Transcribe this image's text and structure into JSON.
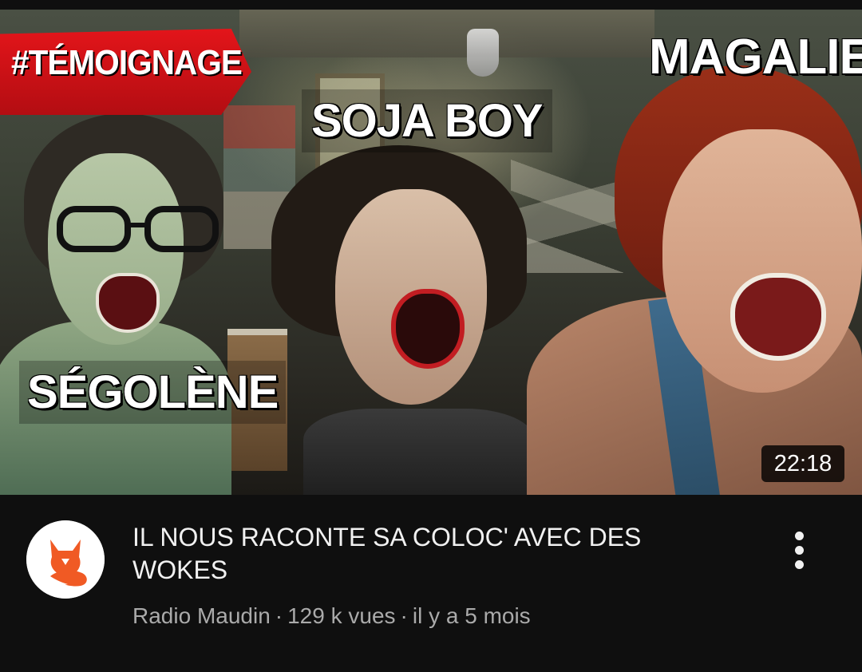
{
  "video": {
    "thumbnail": {
      "tag_text": "#TÉMOIGNAGE",
      "names": {
        "center": "SOJA BOY",
        "right": "MAGALIE",
        "left": "SÉGOLÈNE"
      },
      "duration": "22:18",
      "tag_color": "#d81118"
    },
    "title": "IL NOUS RACONTE SA COLOC' AVEC DES WOKES",
    "channel": {
      "name": "Radio Maudin",
      "avatar_icon": "fox-logo-icon",
      "avatar_color": "#f05a24"
    },
    "views": "129 k vues",
    "age": "il y a 5 mois",
    "separator": "·",
    "menu_icon": "more-vert-icon"
  }
}
